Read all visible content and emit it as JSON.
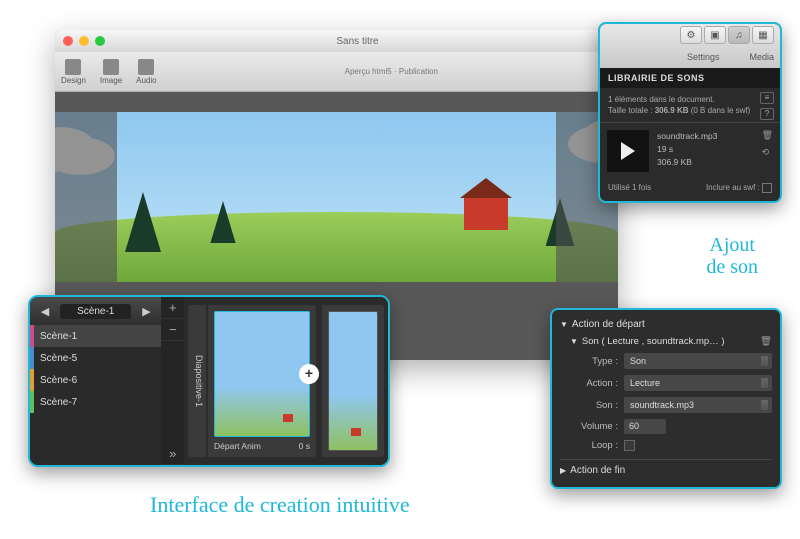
{
  "window": {
    "title": "Sans titre"
  },
  "toolbar": {
    "items": [
      "Design",
      "Image",
      "Audio"
    ],
    "center": "Aperçu html5 · Publication"
  },
  "sound": {
    "tabs": {
      "settings": "Settings",
      "media": "Media"
    },
    "header": "LIBRAIRIE DE SONS",
    "count_line": "1 éléments dans le document.",
    "size_line_pre": "Taille totale : ",
    "size": "306.9 KB",
    "size_line_post": " (0 B dans le swf)",
    "track": {
      "name": "soundtrack.mp3",
      "duration": "19 s",
      "filesize": "306.9 KB"
    },
    "used": "Utilisé 1 fois",
    "include": "Inclure au swf :"
  },
  "scenes": {
    "current": "Scène-1",
    "list": [
      "Scène-1",
      "Scène-5",
      "Scène-6",
      "Scène-7"
    ],
    "slide_label": "Diapositive-1",
    "slide_caption": "Départ Anim",
    "slide_time": "0 s"
  },
  "action": {
    "start_header": "Action de départ",
    "sound_header": "Son ( Lecture , soundtrack.mp… )",
    "type_label": "Type :",
    "type_value": "Son",
    "action_label": "Action :",
    "action_value": "Lecture",
    "son_label": "Son :",
    "son_value": "soundtrack.mp3",
    "volume_label": "Volume :",
    "volume_value": "60",
    "loop_label": "Loop :",
    "end_header": "Action de fin"
  },
  "annotations": {
    "sound": "Ajout\nde son",
    "interface": "Interface de creation intuitive"
  }
}
